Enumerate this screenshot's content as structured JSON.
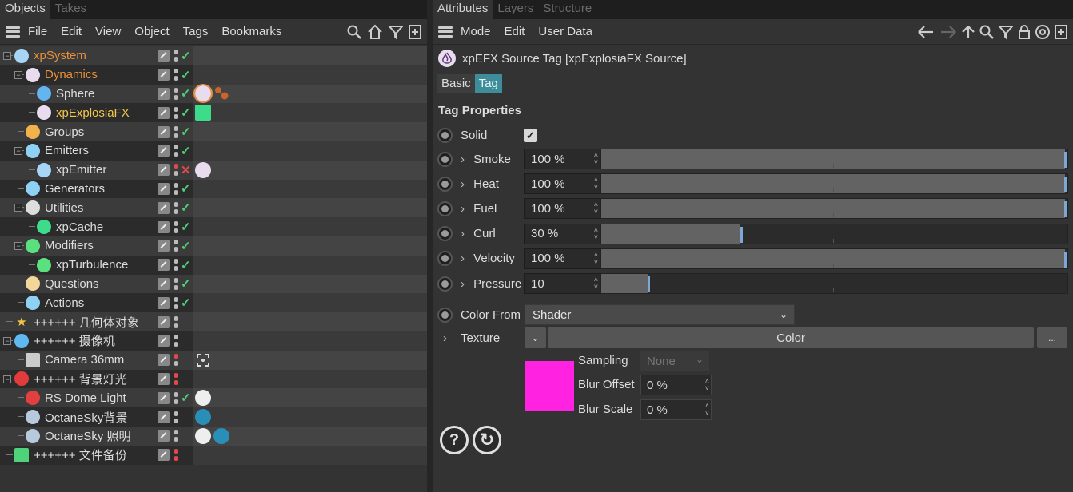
{
  "left": {
    "tabs": [
      "Objects",
      "Takes"
    ],
    "menu": [
      "File",
      "Edit",
      "View",
      "Object",
      "Tags",
      "Bookmarks"
    ],
    "tools": [
      "search-icon",
      "home-icon",
      "filter-icon",
      "new-object-icon"
    ],
    "objects": [
      {
        "name": "xpSystem",
        "color": "orange",
        "icon": "xp-system-icon",
        "status": "check",
        "tags": []
      },
      {
        "name": "Dynamics",
        "color": "orange",
        "icon": "dynamics-group-icon",
        "status": "check",
        "tags": []
      },
      {
        "name": "Sphere",
        "color": "normal",
        "icon": "sphere-icon",
        "status": "check",
        "tags": [
          "xpefx-source-tag-icon",
          "material-balls-icon"
        ]
      },
      {
        "name": "xpExplosiaFX",
        "color": "yellow",
        "icon": "xp-explosiafx-icon",
        "status": "check",
        "tags": [
          "xpcache-tag-icon"
        ]
      },
      {
        "name": "Groups",
        "color": "normal",
        "icon": "groups-icon",
        "status": "check",
        "tags": []
      },
      {
        "name": "Emitters",
        "color": "normal",
        "icon": "emitters-icon",
        "status": "check",
        "tags": []
      },
      {
        "name": "xpEmitter",
        "color": "normal",
        "icon": "xp-emitter-icon",
        "status": "cross",
        "tags": [
          "xpefx-source-tag-icon"
        ]
      },
      {
        "name": "Generators",
        "color": "normal",
        "icon": "generators-icon",
        "status": "check",
        "tags": []
      },
      {
        "name": "Utilities",
        "color": "normal",
        "icon": "utilities-icon",
        "status": "check",
        "tags": []
      },
      {
        "name": "xpCache",
        "color": "normal",
        "icon": "xp-cache-icon",
        "status": "check",
        "tags": []
      },
      {
        "name": "Modifiers",
        "color": "normal",
        "icon": "modifiers-icon",
        "status": "check",
        "tags": []
      },
      {
        "name": "xpTurbulence",
        "color": "normal",
        "icon": "xp-turbulence-icon",
        "status": "check",
        "tags": []
      },
      {
        "name": "Questions",
        "color": "normal",
        "icon": "questions-icon",
        "status": "check",
        "tags": []
      },
      {
        "name": "Actions",
        "color": "normal",
        "icon": "actions-icon",
        "status": "check",
        "tags": []
      },
      {
        "name": "++++++ 几何体对象",
        "color": "normal",
        "icon": "star-null-icon",
        "status": "none",
        "tags": []
      },
      {
        "name": "++++++ 摄像机",
        "color": "normal",
        "icon": "eye-null-icon",
        "status": "none",
        "tags": []
      },
      {
        "name": "Camera 36mm",
        "color": "normal",
        "icon": "camera-icon",
        "status": "none",
        "tags": [
          "camera-target-tag-icon"
        ]
      },
      {
        "name": "++++++ 背景灯光",
        "color": "normal",
        "icon": "red-null-icon",
        "status": "none",
        "tags": []
      },
      {
        "name": "RS Dome Light",
        "color": "normal",
        "icon": "rs-dome-light-icon",
        "status": "check",
        "tags": [
          "compositing-tag-icon"
        ]
      },
      {
        "name": "OctaneSky背景",
        "color": "normal",
        "icon": "octane-sky-icon",
        "status": "none",
        "tags": [
          "octane-environment-tag-icon"
        ]
      },
      {
        "name": "OctaneSky 照明",
        "color": "normal",
        "icon": "octane-sky-icon",
        "status": "none",
        "tags": [
          "compositing-tag-icon",
          "octane-environment-tag-icon"
        ]
      },
      {
        "name": "++++++ 文件备份",
        "color": "normal",
        "icon": "folder-icon",
        "status": "none",
        "tags": []
      }
    ]
  },
  "right": {
    "tabs": [
      "Attributes",
      "Layers",
      "Structure"
    ],
    "menu": [
      "Mode",
      "Edit",
      "User Data"
    ],
    "title": "xpEFX Source Tag [xpExplosiaFX Source]",
    "subtabs": [
      "Basic",
      "Tag"
    ],
    "section_title": "Tag Properties",
    "solid": {
      "label": "Solid",
      "checked": true
    },
    "params": [
      {
        "label": "Smoke",
        "value": "100 %",
        "fraction": 1.0
      },
      {
        "label": "Heat",
        "value": "100 %",
        "fraction": 1.0
      },
      {
        "label": "Fuel",
        "value": "100 %",
        "fraction": 1.0
      },
      {
        "label": "Curl",
        "value": "30 %",
        "fraction": 0.3
      },
      {
        "label": "Velocity",
        "value": "100 %",
        "fraction": 1.0
      },
      {
        "label": "Pressure",
        "value": "10",
        "fraction": 0.1
      }
    ],
    "color_from": {
      "label": "Color From",
      "value": "Shader"
    },
    "texture": {
      "label": "Texture",
      "button": "Color",
      "more": "..."
    },
    "swatch_color": "#ff22e0",
    "sampling": {
      "label": "Sampling",
      "value": "None"
    },
    "blur_offset": {
      "label": "Blur Offset",
      "value": "0 %"
    },
    "blur_scale": {
      "label": "Blur Scale",
      "value": "0 %"
    }
  },
  "colors": {
    "accent_tab": "#3d8d9a",
    "orange_text": "#e8913a",
    "yellow_text": "#f2c64b",
    "check_green": "#4fd17a",
    "cross_red": "#e04a4a"
  }
}
